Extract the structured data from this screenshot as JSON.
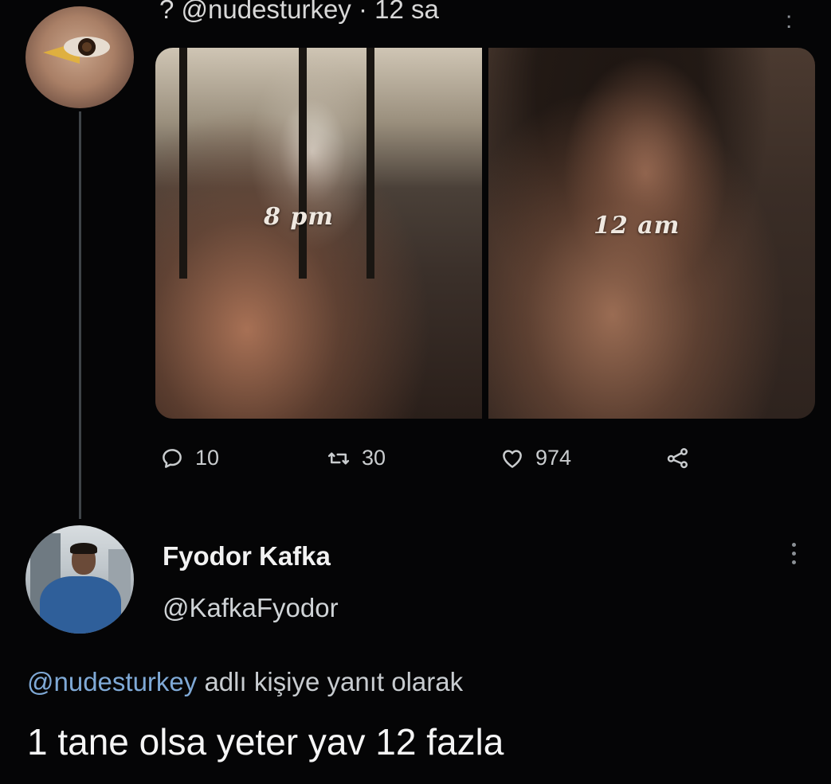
{
  "parent_tweet": {
    "handle_line": "? @nudesturkey · 12 sa",
    "more_label": ":",
    "media": {
      "left_caption": "8 pm",
      "right_caption": "12 am"
    },
    "actions": {
      "reply_count": "10",
      "retweet_count": "30",
      "like_count": "974"
    }
  },
  "reply_tweet": {
    "author_name": "Fyodor Kafka",
    "author_handle": "@KafkaFyodor",
    "reply_to_mention": "@nudesturkey",
    "reply_to_suffix": " adlı kişiye yanıt olarak",
    "text": "1 tane olsa yeter yav 12 fazla"
  },
  "icons": {
    "reply": "speech-bubble-icon",
    "retweet": "retweet-icon",
    "like": "heart-icon",
    "share": "share-icon",
    "more": "more-dots-icon"
  },
  "colors": {
    "background": "#050506",
    "mention": "#7fa9d6",
    "text_primary": "#f5f5f5",
    "text_secondary": "#c9ccce"
  }
}
